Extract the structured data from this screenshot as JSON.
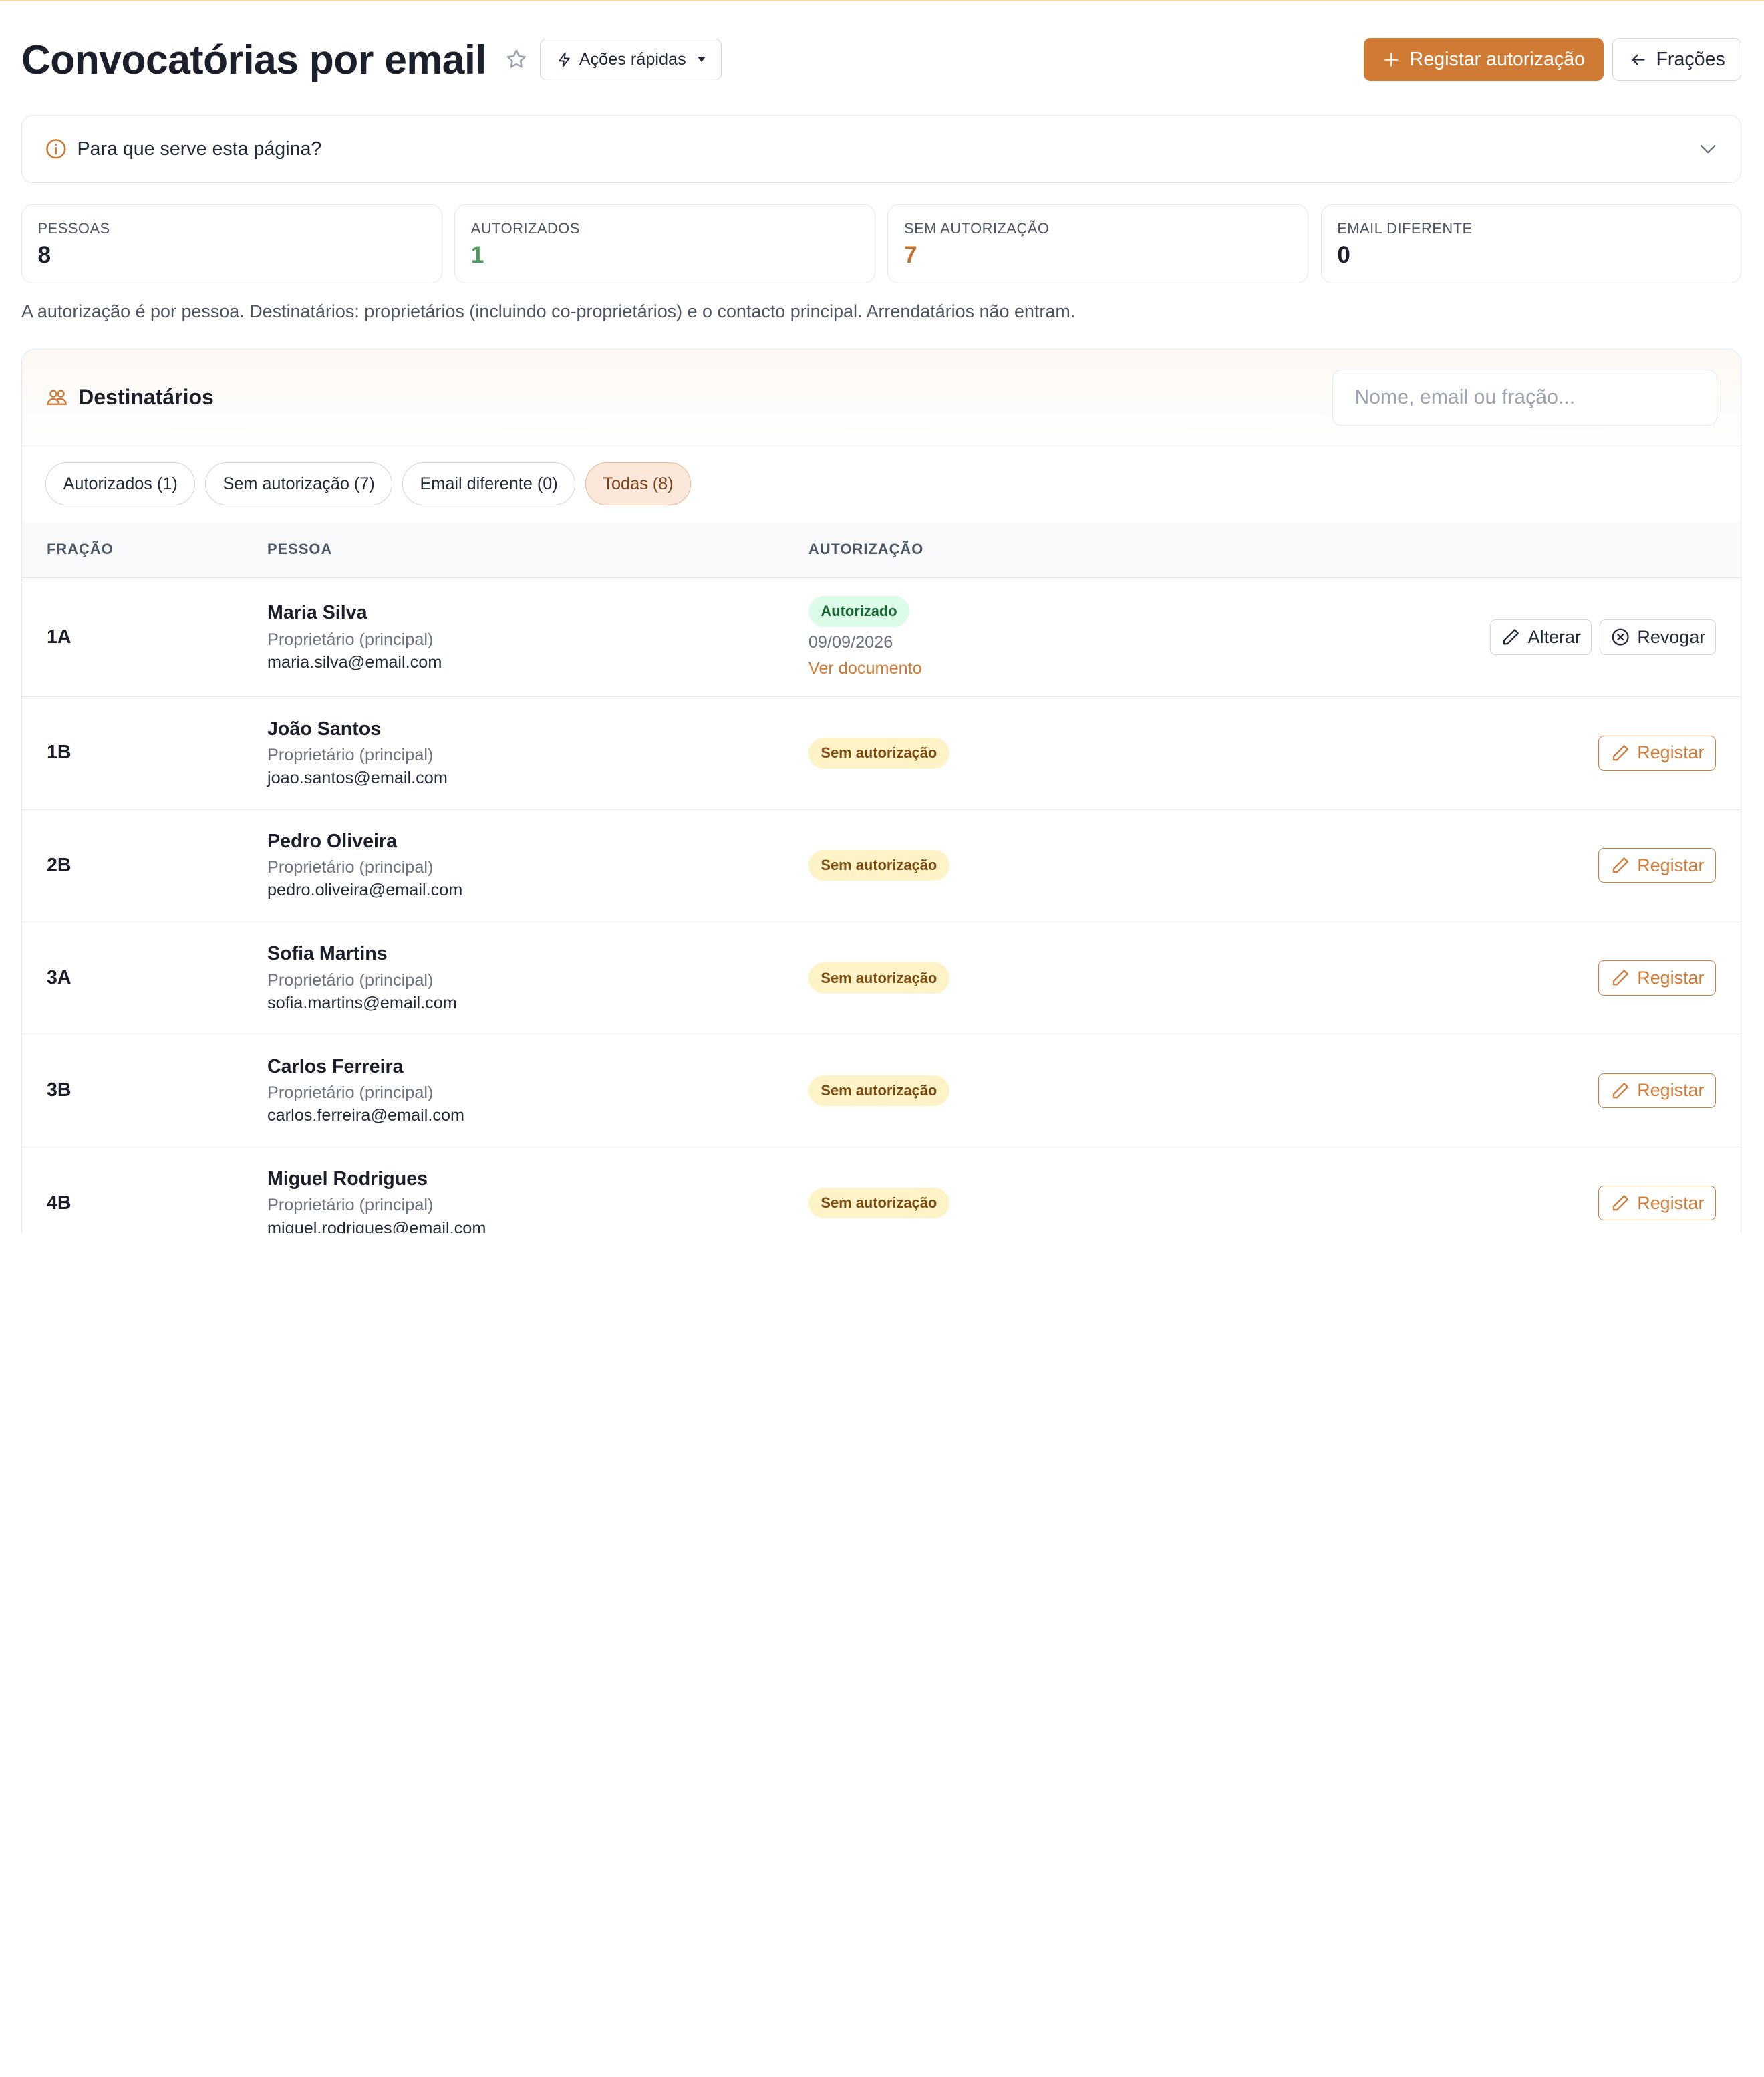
{
  "header": {
    "title": "Convocatórias por email",
    "quick_actions_label": "Ações rápidas",
    "register_label": "Registar autorização",
    "back_label": "Frações"
  },
  "info": {
    "question": "Para que serve esta página?"
  },
  "stats": [
    {
      "label": "PESSOAS",
      "value": "8",
      "color": "#1a1f2b"
    },
    {
      "label": "AUTORIZADOS",
      "value": "1",
      "color": "#4a9a5a"
    },
    {
      "label": "SEM AUTORIZAÇÃO",
      "value": "7",
      "color": "#c2702e"
    },
    {
      "label": "EMAIL DIFERENTE",
      "value": "0",
      "color": "#1a1f2b"
    }
  ],
  "note": "A autorização é por pessoa. Destinatários: proprietários (incluindo co-proprietários) e o contacto principal. Arrendatários não entram.",
  "recipients": {
    "title": "Destinatários",
    "search_placeholder": "Nome, email ou fração...",
    "filters": [
      {
        "label": "Autorizados (1)",
        "active": false
      },
      {
        "label": "Sem autorização (7)",
        "active": false
      },
      {
        "label": "Email diferente (0)",
        "active": false
      },
      {
        "label": "Todas (8)",
        "active": true
      }
    ],
    "columns": {
      "fraction": "FRAÇÃO",
      "person": "PESSOA",
      "authorization": "AUTORIZAÇÃO"
    },
    "rows": [
      {
        "fraction": "1A",
        "name": "Maria Silva",
        "role": "Proprietário (principal)",
        "email": "maria.silva@email.com",
        "status": "Autorizado",
        "date": "09/09/2026",
        "doc_link": "Ver documento",
        "edit_label": "Alterar",
        "revoke_label": "Revogar"
      },
      {
        "fraction": "1B",
        "name": "João Santos",
        "role": "Proprietário (principal)",
        "email": "joao.santos@email.com",
        "status": "Sem autorização",
        "action_label": "Registar"
      },
      {
        "fraction": "2B",
        "name": "Pedro Oliveira",
        "role": "Proprietário (principal)",
        "email": "pedro.oliveira@email.com",
        "status": "Sem autorização",
        "action_label": "Registar"
      },
      {
        "fraction": "3A",
        "name": "Sofia Martins",
        "role": "Proprietário (principal)",
        "email": "sofia.martins@email.com",
        "status": "Sem autorização",
        "action_label": "Registar"
      },
      {
        "fraction": "3B",
        "name": "Carlos Ferreira",
        "role": "Proprietário (principal)",
        "email": "carlos.ferreira@email.com",
        "status": "Sem autorização",
        "action_label": "Registar"
      },
      {
        "fraction": "4B",
        "name": "Miguel Rodrigues",
        "role": "Proprietário (principal)",
        "email": "miguel.rodrigues@email.com",
        "status": "Sem autorização",
        "action_label": "Registar"
      }
    ]
  },
  "colors": {
    "accent": "#cf7a35",
    "success": "#166534",
    "warning": "#7c4a10"
  }
}
